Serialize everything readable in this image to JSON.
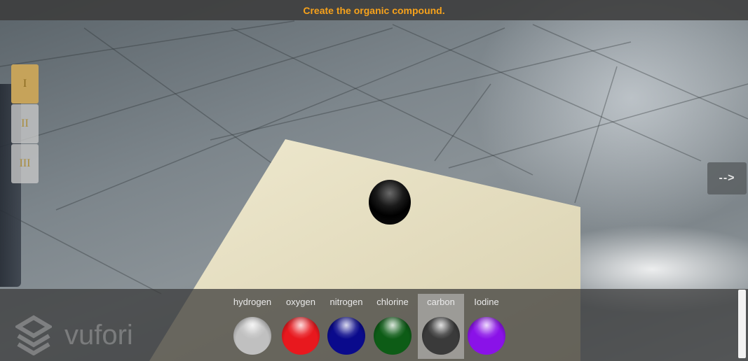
{
  "header": {
    "instruction": "Create the organic compound."
  },
  "levels": [
    {
      "label": "I",
      "active": true
    },
    {
      "label": "II",
      "active": false
    },
    {
      "label": "III",
      "active": false
    }
  ],
  "next_button": {
    "label": "-->"
  },
  "watermark": {
    "text": "vufori"
  },
  "elements": [
    {
      "name": "hydrogen",
      "color": "#c0c0c0",
      "selected": false
    },
    {
      "name": "oxygen",
      "color": "#e8181e",
      "selected": false
    },
    {
      "name": "nitrogen",
      "color": "#0a0a8c",
      "selected": false
    },
    {
      "name": "chlorine",
      "color": "#0d5c16",
      "selected": false
    },
    {
      "name": "carbon",
      "color": "#3a3a3a",
      "selected": true
    },
    {
      "name": "Iodine",
      "color": "#8a12e8",
      "selected": false
    }
  ],
  "scene": {
    "placed_atom_color": "#000000"
  }
}
